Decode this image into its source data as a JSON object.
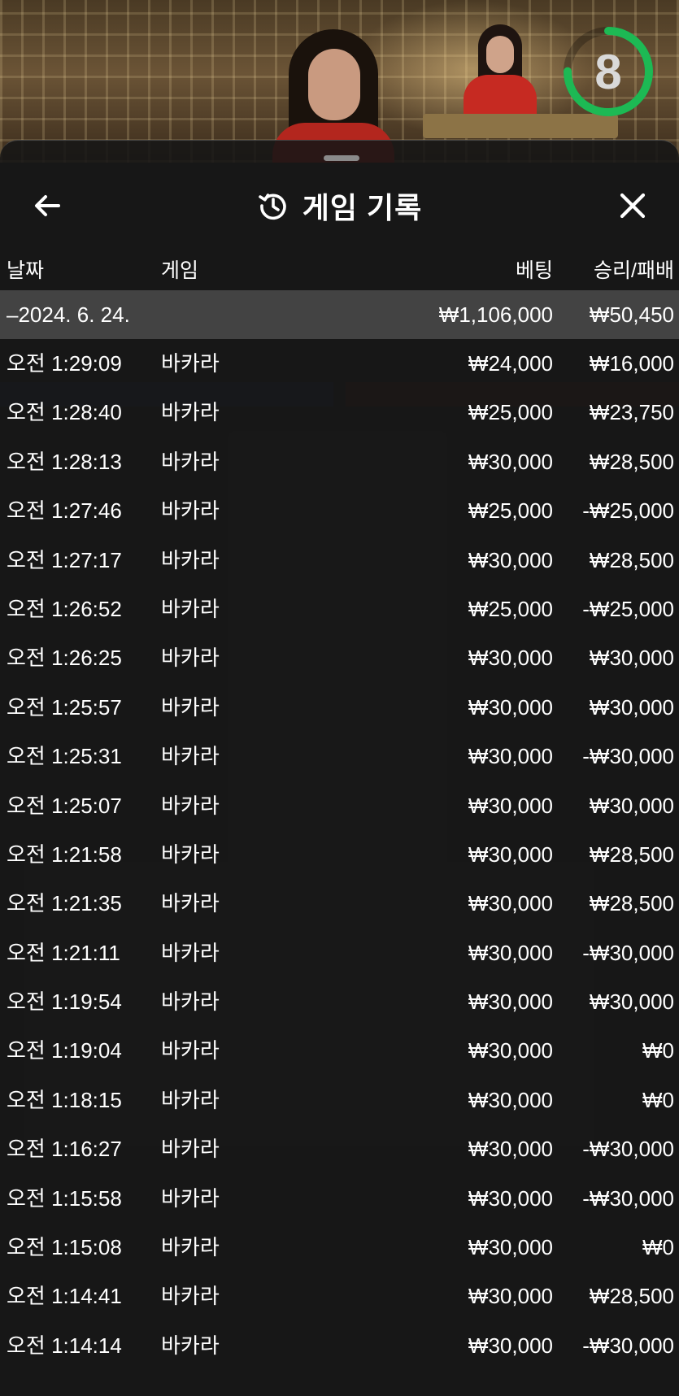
{
  "timer": {
    "value": "8",
    "progress": 0.75
  },
  "header": {
    "title": "게임 기록",
    "back_icon": "arrow-left-icon",
    "history_icon": "history-icon",
    "close_icon": "close-icon"
  },
  "columns": {
    "date": "날짜",
    "game": "게임",
    "bet": "베팅",
    "result": "승리/패배"
  },
  "colors": {
    "accent": "#1db954",
    "sheet_bg": "#161616",
    "group_row_bg": "#464646"
  },
  "group": {
    "label": "–2024. 6. 24.",
    "bet": "₩1,106,000",
    "result": "₩50,450"
  },
  "rows": [
    {
      "time": "오전 1:29:09",
      "game": "바카라",
      "bet": "₩24,000",
      "result": "₩16,000"
    },
    {
      "time": "오전 1:28:40",
      "game": "바카라",
      "bet": "₩25,000",
      "result": "₩23,750"
    },
    {
      "time": "오전 1:28:13",
      "game": "바카라",
      "bet": "₩30,000",
      "result": "₩28,500"
    },
    {
      "time": "오전 1:27:46",
      "game": "바카라",
      "bet": "₩25,000",
      "result": "-₩25,000"
    },
    {
      "time": "오전 1:27:17",
      "game": "바카라",
      "bet": "₩30,000",
      "result": "₩28,500"
    },
    {
      "time": "오전 1:26:52",
      "game": "바카라",
      "bet": "₩25,000",
      "result": "-₩25,000"
    },
    {
      "time": "오전 1:26:25",
      "game": "바카라",
      "bet": "₩30,000",
      "result": "₩30,000"
    },
    {
      "time": "오전 1:25:57",
      "game": "바카라",
      "bet": "₩30,000",
      "result": "₩30,000"
    },
    {
      "time": "오전 1:25:31",
      "game": "바카라",
      "bet": "₩30,000",
      "result": "-₩30,000"
    },
    {
      "time": "오전 1:25:07",
      "game": "바카라",
      "bet": "₩30,000",
      "result": "₩30,000"
    },
    {
      "time": "오전 1:21:58",
      "game": "바카라",
      "bet": "₩30,000",
      "result": "₩28,500"
    },
    {
      "time": "오전 1:21:35",
      "game": "바카라",
      "bet": "₩30,000",
      "result": "₩28,500"
    },
    {
      "time": "오전 1:21:11",
      "game": "바카라",
      "bet": "₩30,000",
      "result": "-₩30,000"
    },
    {
      "time": "오전 1:19:54",
      "game": "바카라",
      "bet": "₩30,000",
      "result": "₩30,000"
    },
    {
      "time": "오전 1:19:04",
      "game": "바카라",
      "bet": "₩30,000",
      "result": "₩0"
    },
    {
      "time": "오전 1:18:15",
      "game": "바카라",
      "bet": "₩30,000",
      "result": "₩0"
    },
    {
      "time": "오전 1:16:27",
      "game": "바카라",
      "bet": "₩30,000",
      "result": "-₩30,000"
    },
    {
      "time": "오전 1:15:58",
      "game": "바카라",
      "bet": "₩30,000",
      "result": "-₩30,000"
    },
    {
      "time": "오전 1:15:08",
      "game": "바카라",
      "bet": "₩30,000",
      "result": "₩0"
    },
    {
      "time": "오전 1:14:41",
      "game": "바카라",
      "bet": "₩30,000",
      "result": "₩28,500"
    },
    {
      "time": "오전 1:14:14",
      "game": "바카라",
      "bet": "₩30,000",
      "result": "-₩30,000"
    }
  ]
}
